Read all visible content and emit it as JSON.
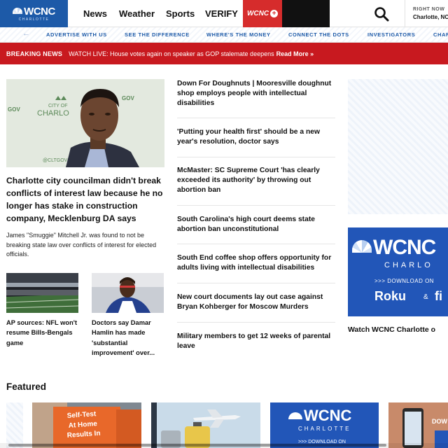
{
  "header": {
    "logo_text": "WCNC",
    "logo_sub": "CHARLOTTE",
    "nav": [
      "News",
      "Weather",
      "Sports",
      "VERIFY"
    ],
    "plus_label": "WCNC",
    "plus_symbol": "+",
    "weather_label": "RIGHT NOW",
    "weather_location": "Charlotte, NC"
  },
  "subnav": {
    "back_arrow": "←",
    "links": [
      "ADVERTISE WITH US",
      "SEE THE DIFFERENCE",
      "WHERE'S THE MONEY",
      "CONNECT THE DOTS",
      "INVESTIGATORS",
      "CHAR"
    ]
  },
  "breaking": {
    "label": "BREAKING NEWS",
    "text": "WATCH LIVE: House votes again on speaker as GOP stalemate deepens",
    "more": "Read More »"
  },
  "lead": {
    "image_backdrop_text": [
      "CITY OF",
      "CHARLO",
      "GOV",
      "@CLTGOV"
    ],
    "title": "Charlotte city councilman didn't break conflicts of interest law because he no longer has stake in construction company, Mecklenburg DA says",
    "description": "James \"Smuggie\" Mitchell Jr. was found to not be breaking state law over conflicts of interest for elected officials."
  },
  "small_stories": [
    {
      "title": "AP sources: NFL won't resume Bills-Bengals game"
    },
    {
      "title": "Doctors say Damar Hamlin has made 'substantial improvement' over..."
    }
  ],
  "headlines": [
    "Down For Doughnuts | Mooresville doughnut shop employs people with intellectual disabilities",
    "'Putting your health first' should be a new year's resolution, doctor says",
    "McMaster: SC Supreme Court 'has clearly exceeded its authority' by throwing out abortion ban",
    "South Carolina's high court deems state abortion ban unconstitutional",
    "South End coffee shop offers opportunity for adults living with intellectual disabilities",
    "New court documents lay out case against Bryan Kohberger for Moscow Murders",
    "Military members to get 12 weeks of parental leave"
  ],
  "promo": {
    "logo": "WCNC",
    "city": "CHARLO",
    "download": ">>> DOWNLOAD ON",
    "roku": "Roku",
    "and": "&",
    "fire": "fi",
    "caption": "Watch WCNC Charlotte o"
  },
  "featured": {
    "title": "Featured",
    "card1_text": [
      "Self-Test",
      "At Home",
      "Results In"
    ],
    "card3_logo": "WCNC",
    "card3_city": "CHARLOTTE",
    "card3_download": ">>> DOWNLOAD ON",
    "card4_text": "DOW"
  },
  "colors": {
    "brand_blue": "#1d5aa8",
    "breaking_red": "#c8191f",
    "plus_red": "#d62c2c",
    "promo_blue": "#2256b8"
  }
}
